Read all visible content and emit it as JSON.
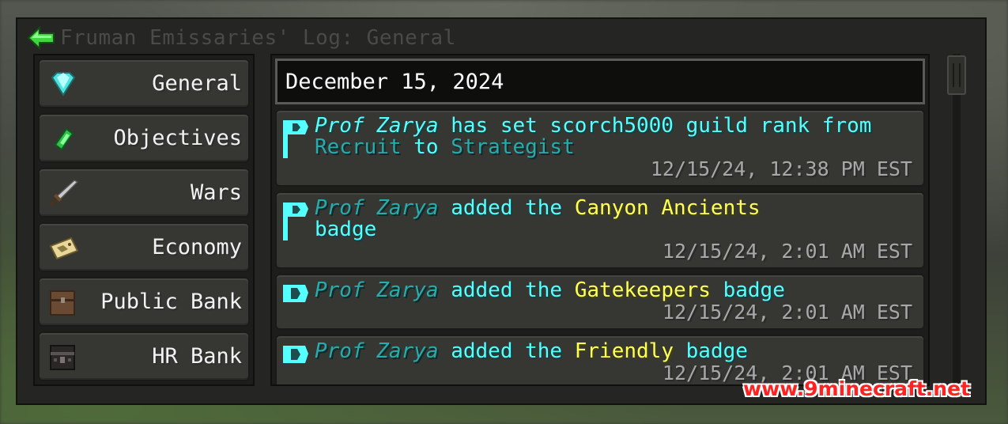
{
  "window": {
    "title": "Fruman Emissaries' Log: General"
  },
  "sidebar": {
    "items": [
      {
        "label": "General",
        "icon": "diamond-icon"
      },
      {
        "label": "Objectives",
        "icon": "emerald-icon"
      },
      {
        "label": "Wars",
        "icon": "sword-icon"
      },
      {
        "label": "Economy",
        "icon": "map-icon"
      },
      {
        "label": "Public Bank",
        "icon": "chest-icon"
      },
      {
        "label": "HR Bank",
        "icon": "iron-chest-icon"
      }
    ]
  },
  "log": {
    "date": "December 15, 2024",
    "entries": [
      {
        "actor": "Prof Zarya",
        "action": "has set scorch5000 guild rank from",
        "from": "Recruit",
        "to_word": "to",
        "to": "Strategist",
        "timestamp": "12/15/24, 12:38 PM EST"
      },
      {
        "actor": "Prof Zarya",
        "action": "added the",
        "badge": "Canyon Ancients",
        "suffix": "badge",
        "timestamp": "12/15/24, 2:01 AM EST"
      },
      {
        "actor": "Prof Zarya",
        "action": "added the",
        "badge": "Gatekeepers",
        "suffix": "badge",
        "timestamp": "12/15/24, 2:01 AM EST"
      },
      {
        "actor": "Prof Zarya",
        "action": "added the",
        "badge": "Friendly",
        "suffix": "badge",
        "timestamp": "12/15/24, 2:01 AM EST"
      }
    ]
  },
  "watermark": "www.9minecraft.net",
  "colors": {
    "accent_cyan": "#55ffff",
    "dim_cyan": "#2aaaaa",
    "badge_yellow": "#ffff55",
    "back_arrow": "#3fd63f"
  }
}
